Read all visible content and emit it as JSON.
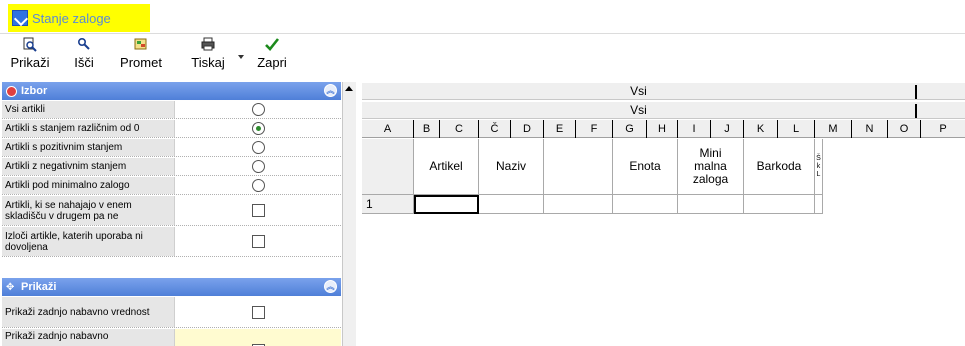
{
  "window": {
    "title": "Stanje zaloge"
  },
  "toolbar": {
    "buttons": [
      {
        "label": "Prikaži",
        "icon": "preview-icon"
      },
      {
        "label": "Išči",
        "icon": "search-icon"
      },
      {
        "label": "Promet",
        "icon": "traffic-icon"
      },
      {
        "label": "Tiskaj",
        "icon": "printer-icon"
      },
      {
        "label": "Zapri",
        "icon": "checkmark-icon"
      }
    ]
  },
  "left_panel": {
    "sections": [
      {
        "title": "Izbor",
        "items": [
          {
            "label": "Vsi artikli",
            "control": "radio",
            "checked": false
          },
          {
            "label": "Artikli s stanjem različnim od 0",
            "control": "radio",
            "checked": true
          },
          {
            "label": "Artikli s pozitivnim stanjem",
            "control": "radio",
            "checked": false
          },
          {
            "label": "Artikli z negativnim stanjem",
            "control": "radio",
            "checked": false
          },
          {
            "label": "Artikli pod minimalno zalogo",
            "control": "radio",
            "checked": false
          },
          {
            "label": "Artikli, ki se nahajajo v enem skladišču v drugem pa ne",
            "control": "checkbox",
            "checked": false
          },
          {
            "label": "Izloči artikle, katerih uporaba ni dovoljena",
            "control": "checkbox",
            "checked": false
          }
        ]
      },
      {
        "title": "Prikaži",
        "items": [
          {
            "label": "Prikaži zadnjo nabavno vrednost",
            "control": "checkbox",
            "checked": false
          },
          {
            "label": "Prikaži zadnjo nabavno",
            "control": "checkbox",
            "checked": false
          }
        ]
      }
    ]
  },
  "grid": {
    "header_rows": [
      "Vsi",
      "Vsi"
    ],
    "column_letters": [
      "A",
      "B",
      "C",
      "Č",
      "D",
      "E",
      "F",
      "G",
      "H",
      "I",
      "J",
      "K",
      "L",
      "M",
      "N",
      "O",
      "P"
    ],
    "column_titles": [
      "Artikel",
      "Naziv",
      "",
      "Enota",
      "Mini malna zaloga",
      "Barkoda",
      "Š k L"
    ],
    "row_numbers": [
      "1"
    ]
  },
  "colors": {
    "title_highlight": "#ffff00",
    "section_header": "#5b88dd",
    "label_bg": "#e6e6e6"
  }
}
